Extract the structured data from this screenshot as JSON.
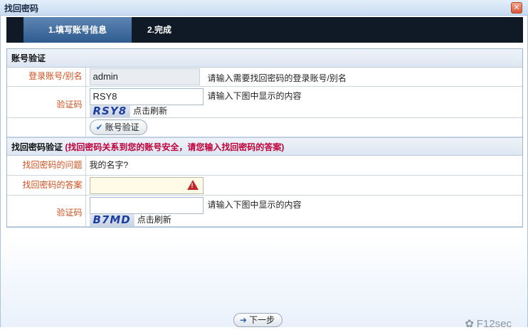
{
  "window": {
    "title": "找回密码"
  },
  "steps": [
    {
      "label": "1.填写账号信息"
    },
    {
      "label": "2.完成"
    }
  ],
  "account_verify": {
    "heading": "账号验证",
    "login_label": "登录账号/别名",
    "login_value": "admin",
    "login_hint": "请输入需要找回密码的登录账号/别名",
    "captcha_label": "验证码",
    "captcha_value": "RSY8",
    "captcha_hint": "请输入下图中显示的内容",
    "captcha_image_text": "RSY8",
    "refresh_label": "点击刷新",
    "verify_button": "账号验证"
  },
  "password_verify": {
    "heading": "找回密码验证",
    "heading_warning": "(找回密码关系到您的账号安全，请您输入找回密码的答案)",
    "question_label": "找回密码的问题",
    "question_value": "我的名字?",
    "answer_label": "找回密码的答案",
    "answer_value": "",
    "captcha_label": "验证码",
    "captcha_value": "",
    "captcha_hint": "请输入下图中显示的内容",
    "captcha_image_text": "B7MD",
    "refresh_label": "点击刷新"
  },
  "footer": {
    "next_button": "下一步"
  },
  "watermark": {
    "text": "F12sec"
  },
  "colors": {
    "label": "#d2501e",
    "warning": "#c0003a",
    "stepbar": "#0f1a26",
    "step_active": "#3d6aa0"
  }
}
